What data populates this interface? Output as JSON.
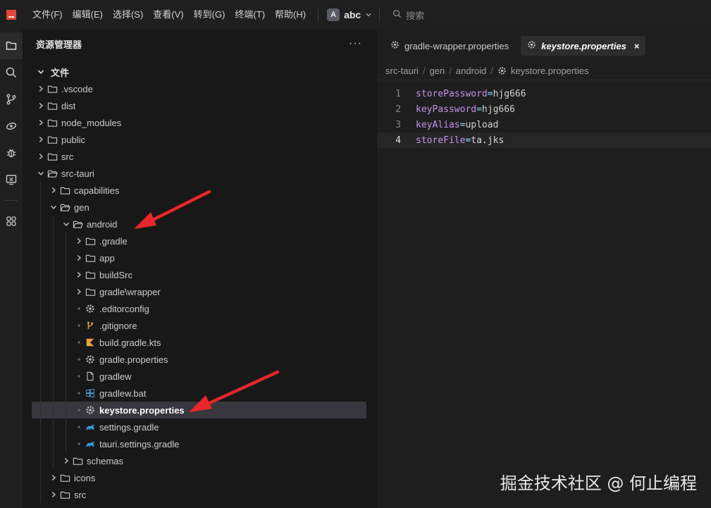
{
  "titlebar": {
    "menu": [
      "文件(F)",
      "编辑(E)",
      "选择(S)",
      "查看(V)",
      "转到(G)",
      "终端(T)",
      "帮助(H)"
    ],
    "workspace_avatar": "A",
    "workspace_name": "abc",
    "search_placeholder": "搜索"
  },
  "activitybar": {
    "icons": [
      "explorer-icon",
      "search-icon",
      "source-control-icon",
      "remote-explorer-icon",
      "debug-icon",
      "remote-window-icon",
      "extensions-icon"
    ]
  },
  "sidebar": {
    "title": "资源管理器",
    "section_title": "文件",
    "items": [
      {
        "label": ".vscode",
        "kind": "folder"
      },
      {
        "label": "dist",
        "kind": "folder"
      },
      {
        "label": "node_modules",
        "kind": "folder"
      },
      {
        "label": "public",
        "kind": "folder"
      },
      {
        "label": "src",
        "kind": "folder"
      },
      {
        "label": "src-tauri",
        "kind": "folder-open"
      },
      {
        "label": "capabilities",
        "kind": "folder"
      },
      {
        "label": "gen",
        "kind": "folder-open"
      },
      {
        "label": "android",
        "kind": "folder-open"
      },
      {
        "label": ".gradle",
        "kind": "folder"
      },
      {
        "label": "app",
        "kind": "folder"
      },
      {
        "label": "buildSrc",
        "kind": "folder"
      },
      {
        "label": "gradle\\wrapper",
        "kind": "folder"
      },
      {
        "label": ".editorconfig",
        "kind": "gear-file"
      },
      {
        "label": ".gitignore",
        "kind": "git-file"
      },
      {
        "label": "build.gradle.kts",
        "kind": "kotlin-file"
      },
      {
        "label": "gradle.properties",
        "kind": "gear-file"
      },
      {
        "label": "gradlew",
        "kind": "plain-file"
      },
      {
        "label": "gradlew.bat",
        "kind": "windows-file"
      },
      {
        "label": "keystore.properties",
        "kind": "gear-file",
        "selected": true
      },
      {
        "label": "settings.gradle",
        "kind": "gradle-file"
      },
      {
        "label": "tauri.settings.gradle",
        "kind": "gradle-file"
      },
      {
        "label": "schemas",
        "kind": "folder"
      },
      {
        "label": "icons",
        "kind": "folder"
      },
      {
        "label": "src",
        "kind": "folder"
      }
    ]
  },
  "editor": {
    "tabs": [
      {
        "label": "gradle-wrapper.properties",
        "active": false
      },
      {
        "label": "keystore.properties",
        "active": true
      }
    ],
    "tab_close_glyph": "×",
    "breadcrumb": [
      "src-tauri",
      "gen",
      "android",
      "keystore.properties"
    ],
    "lines": [
      {
        "num": "1",
        "key": "storePassword",
        "eq": "=",
        "value": "hjg666"
      },
      {
        "num": "2",
        "key": "keyPassword",
        "eq": "=",
        "value": "hjg666"
      },
      {
        "num": "3",
        "key": "keyAlias",
        "eq": "=",
        "value": "upload"
      },
      {
        "num": "4",
        "key": "storeFile",
        "eq": "=",
        "value": "ta.jks"
      }
    ]
  },
  "watermark": "掘金技术社区 @ 何止编程",
  "colors": {
    "accent_red": "#e5473a",
    "arrow_red": "#e8262b",
    "property_key": "#c792ea",
    "gear_icon": "#c5c5c5",
    "git_icon": "#e8a33d",
    "kotlin_icon": "#e8a33d",
    "gradle_icon": "#3a9ad9",
    "windows_icon": "#4aa3df"
  }
}
